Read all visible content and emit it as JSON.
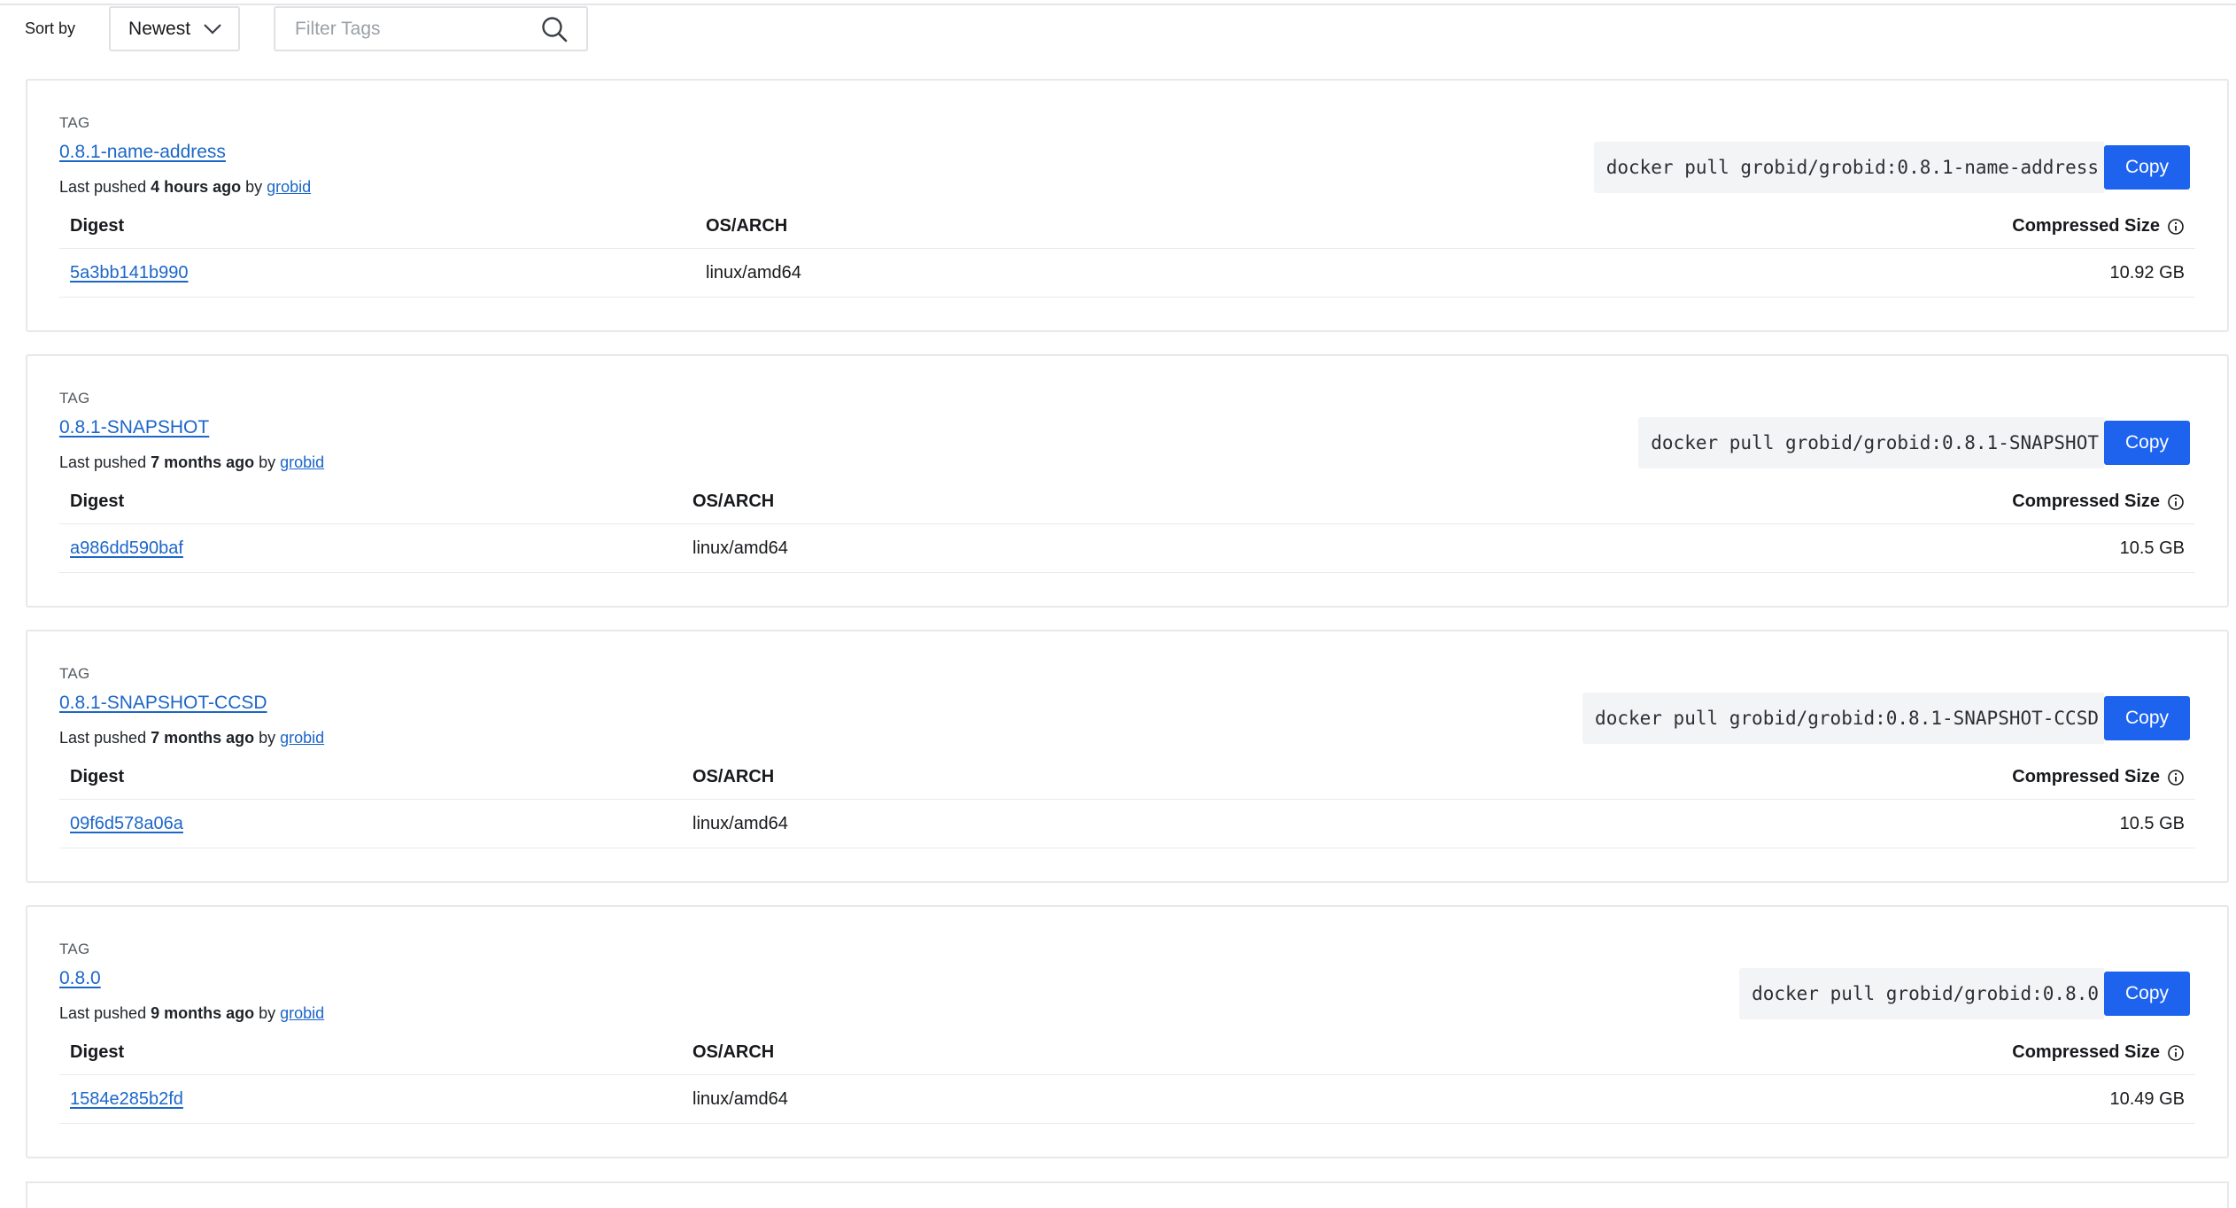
{
  "toolbar": {
    "sort_label": "Sort by",
    "sort_value": "Newest",
    "filter_placeholder": "Filter Tags"
  },
  "columns": {
    "digest": "Digest",
    "os_arch": "OS/ARCH",
    "compressed_size": "Compressed Size"
  },
  "tags": [
    {
      "label": "TAG",
      "name": "0.8.1-name-address",
      "pushed_prefix": "Last pushed ",
      "pushed_when": "4 hours ago",
      "pushed_by": " by ",
      "user": "grobid",
      "pull_command": "docker pull grobid/grobid:0.8.1-name-address",
      "copy_label": "Copy",
      "digest": "5a3bb141b990",
      "os_arch": "linux/amd64",
      "size": "10.92 GB"
    },
    {
      "label": "TAG",
      "name": "0.8.1-SNAPSHOT",
      "pushed_prefix": "Last pushed ",
      "pushed_when": "7 months ago",
      "pushed_by": " by ",
      "user": "grobid",
      "pull_command": "docker pull grobid/grobid:0.8.1-SNAPSHOT",
      "copy_label": "Copy",
      "digest": "a986dd590baf",
      "os_arch": "linux/amd64",
      "size": "10.5 GB"
    },
    {
      "label": "TAG",
      "name": "0.8.1-SNAPSHOT-CCSD",
      "pushed_prefix": "Last pushed ",
      "pushed_when": "7 months ago",
      "pushed_by": " by ",
      "user": "grobid",
      "pull_command": "docker pull grobid/grobid:0.8.1-SNAPSHOT-CCSD",
      "copy_label": "Copy",
      "digest": "09f6d578a06a",
      "os_arch": "linux/amd64",
      "size": "10.5 GB"
    },
    {
      "label": "TAG",
      "name": "0.8.0",
      "pushed_prefix": "Last pushed ",
      "pushed_when": "9 months ago",
      "pushed_by": " by ",
      "user": "grobid",
      "pull_command": "docker pull grobid/grobid:0.8.0",
      "copy_label": "Copy",
      "digest": "1584e285b2fd",
      "os_arch": "linux/amd64",
      "size": "10.49 GB"
    }
  ],
  "colors": {
    "link": "#1b66c9",
    "copy_button": "#1d63ed",
    "border": "#e6e8eb",
    "command_bg": "#f3f4f6"
  },
  "icons": {
    "sort_chevron": "chevron-down-icon",
    "filter": "search-icon",
    "size_info": "info-icon"
  }
}
